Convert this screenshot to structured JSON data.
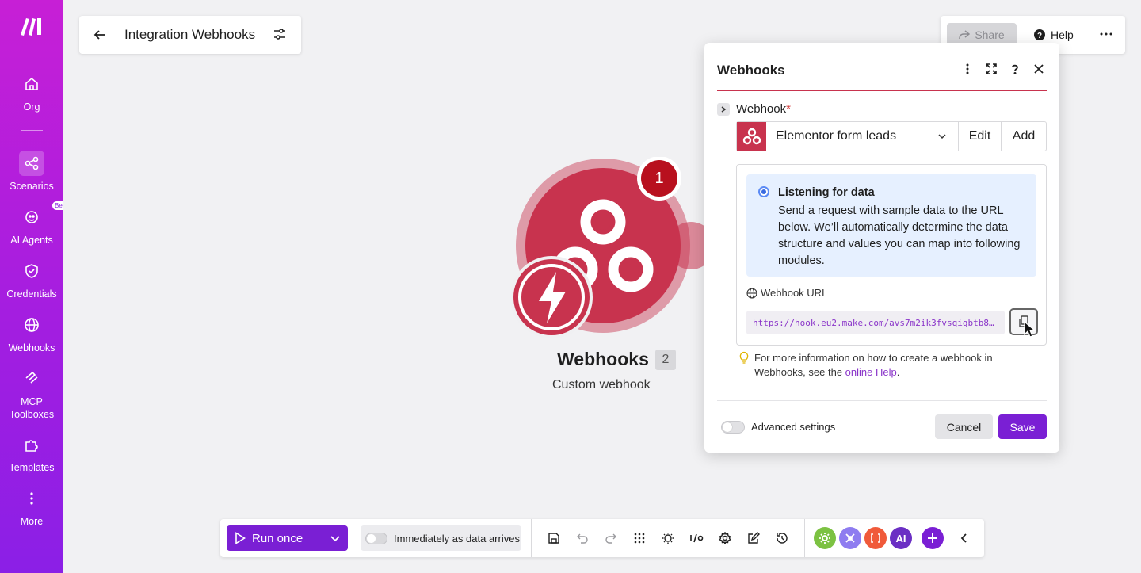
{
  "sidebar": {
    "items": [
      {
        "label": "Org",
        "icon": "home-icon"
      },
      {
        "label": "Scenarios",
        "icon": "share-nodes-icon",
        "active": true
      },
      {
        "label": "AI Agents",
        "icon": "ai-agent-icon",
        "badge": "Beta"
      },
      {
        "label": "Credentials",
        "icon": "shield-check-icon"
      },
      {
        "label": "Webhooks",
        "icon": "globe-icon"
      },
      {
        "label": "MCP\nToolboxes",
        "label_line1": "MCP",
        "label_line2": "Toolboxes",
        "icon": "mcp-icon"
      },
      {
        "label": "Templates",
        "icon": "puzzle-icon"
      },
      {
        "label": "More",
        "icon": "vertical-dots-icon"
      }
    ]
  },
  "header": {
    "scenario_title": "Integration Webhooks",
    "share_label": "Share",
    "help_label": "Help"
  },
  "module": {
    "title": "Webhooks",
    "count": "2",
    "subtitle": "Custom webhook",
    "bundle_badge": "1",
    "brand_color": "#c8334e"
  },
  "dialog": {
    "title": "Webhooks",
    "field_label": "Webhook",
    "required_mark": "*",
    "selected_webhook": "Elementor form leads",
    "edit_label": "Edit",
    "add_label": "Add",
    "listening_title": "Listening for data",
    "listening_text": "Send a request with sample data to the URL below. We’ll automatically determine the data structure and values you can map into following modules.",
    "url_label": "Webhook URL",
    "url_value": "https://hook.eu2.make.com/avs7m2ik3fvsqigbtb8…",
    "hint_text": "For more information on how to create a webhook in Webhooks, see the ",
    "hint_link": "online Help",
    "hint_end": ".",
    "advanced_label": "Advanced settings",
    "cancel_label": "Cancel",
    "save_label": "Save"
  },
  "toolbar": {
    "run_label": "Run once",
    "schedule_label": "Immediately as data arrives",
    "apps": [
      {
        "icon": "gear-app-icon",
        "color": "#7cc242"
      },
      {
        "icon": "tools-app-icon",
        "color": "#8e7cf0"
      },
      {
        "icon": "json-app-icon",
        "color": "#f05a3a"
      },
      {
        "label": "AI",
        "color": "#6b2fc4"
      }
    ],
    "accent": "#7a1fd4"
  }
}
